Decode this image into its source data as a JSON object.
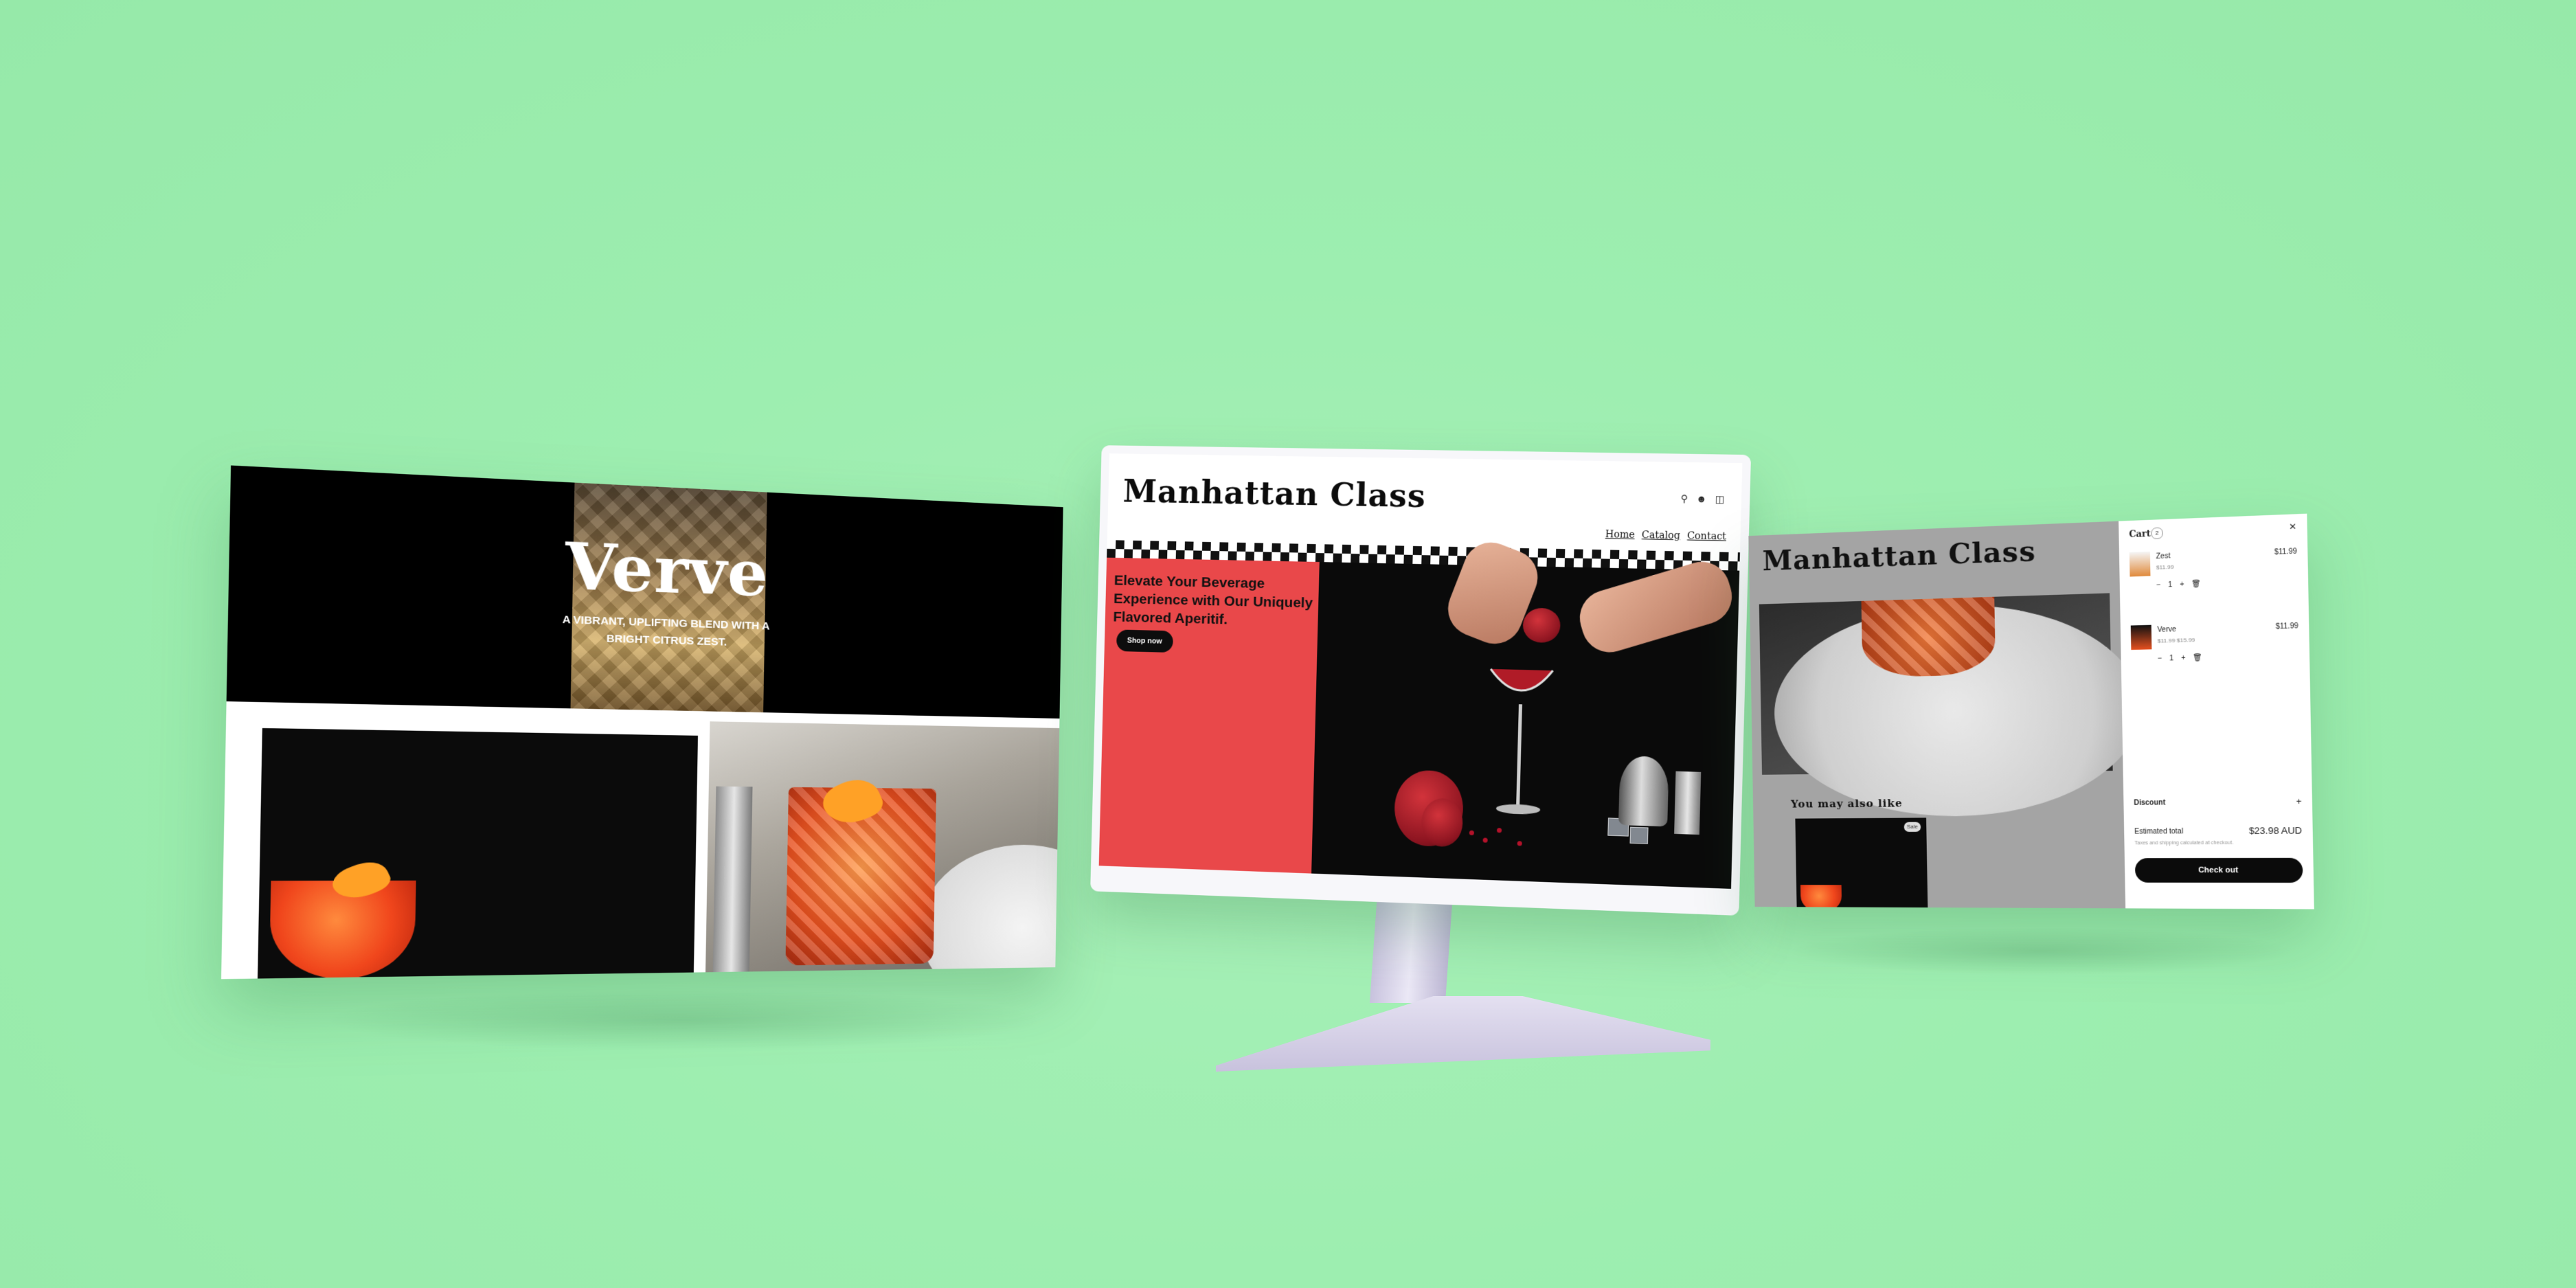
{
  "left_panel": {
    "title": "Verve",
    "subtitle": "A vibrant, uplifting blend with a bright citrus zest."
  },
  "center_monitor": {
    "logo": "Manhattan Class",
    "icons": [
      "search-icon",
      "account-icon",
      "bag-icon"
    ],
    "nav": [
      "Home",
      "Catalog",
      "Contact"
    ],
    "headline": "Elevate Your Beverage Experience with Our Uniquely Flavored Aperitif.",
    "button": "Shop now",
    "colors": {
      "accent": "#e9484a",
      "dark": "#0d0d0d"
    }
  },
  "right_panel": {
    "logo": "Manhattan Class",
    "you_may_also_like": "You may also like",
    "card_badge": "Sale",
    "cart": {
      "title": "Cart",
      "count": "2",
      "items": [
        {
          "name": "Zest",
          "sub": "$11.99",
          "price": "$11.99",
          "qty": "1"
        },
        {
          "name": "Verve",
          "sub": "$11.99 $15.99",
          "price": "$11.99",
          "qty": "1"
        }
      ],
      "discount_label": "Discount",
      "subtotal_label": "Estimated total",
      "subtotal": "$23.98 AUD",
      "note": "Taxes and shipping calculated at checkout.",
      "checkout": "Check out"
    }
  }
}
